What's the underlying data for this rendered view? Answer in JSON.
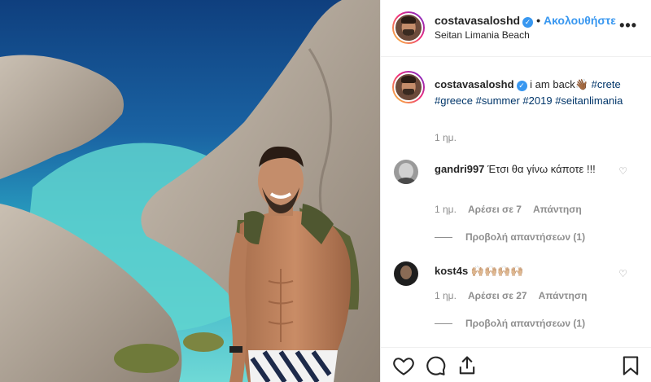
{
  "post": {
    "username": "costavasaloshd",
    "follow_label": "Ακολουθήστε",
    "location": "Seitan Limania Beach",
    "more_label": "•••",
    "verified_mark": "✓"
  },
  "caption": {
    "username": "costavasaloshd",
    "text": "i am back",
    "emoji": "👋🏾",
    "hashtags": [
      "#crete",
      "#greece",
      "#summer",
      "#2019",
      "#seitanlimania"
    ],
    "time": "1 ημ."
  },
  "comments": [
    {
      "username": "gandri997",
      "text": "Έτσι θα γίνω κάποτε !!!",
      "time": "1 ημ.",
      "likes": "Αρέσει σε 7",
      "reply_label": "Απάντηση",
      "view_replies": "Προβολή απαντήσεων (1)"
    },
    {
      "username": "kost4s",
      "text": "🙌🏼🙌🏼🙌🏼🙌🏼",
      "time": "1 ημ.",
      "likes": "Αρέσει σε 27",
      "reply_label": "Απάντηση",
      "view_replies": "Προβολή απαντήσεων (1)"
    }
  ],
  "icons": {
    "like": "heart-icon",
    "comment": "comment-icon",
    "share": "share-icon",
    "save": "bookmark-icon",
    "more": "more-options-icon",
    "verified": "verified-badge-icon"
  },
  "colors": {
    "link_blue": "#3897f0",
    "hashtag": "#003569",
    "muted": "#8e8e8e",
    "text": "#262626",
    "border": "#efefef"
  }
}
